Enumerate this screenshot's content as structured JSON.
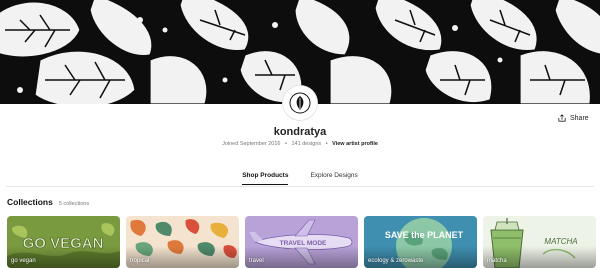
{
  "banner": {
    "pattern": "black-and-white-monstera-leaves"
  },
  "avatar": {
    "icon": "leaf-logo-icon"
  },
  "share": {
    "label": "Share",
    "icon": "share-icon"
  },
  "artist": {
    "name": "kondratya",
    "joined": "Joined September 2016",
    "designs": "141 designs",
    "profile_link": "View artist profile"
  },
  "tabs": [
    {
      "label": "Shop Products",
      "active": true
    },
    {
      "label": "Explore Designs",
      "active": false
    }
  ],
  "collections": {
    "title": "Collections",
    "count": "5 collections",
    "items": [
      {
        "label": "go vegan",
        "art_text": "GO VEGAN",
        "bg": "#6e8f3a"
      },
      {
        "label": "tropical",
        "bg": "#f4e3cf"
      },
      {
        "label": "travel",
        "art_text": "TRAVEL MODE",
        "bg": "#b8a2d8"
      },
      {
        "label": "ecology & zerowaste",
        "art_text": "SAVE the PLANET",
        "bg": "#3f8fb0"
      },
      {
        "label": "matcha",
        "art_text": "MATCHA",
        "bg": "#eef3e8"
      }
    ]
  }
}
